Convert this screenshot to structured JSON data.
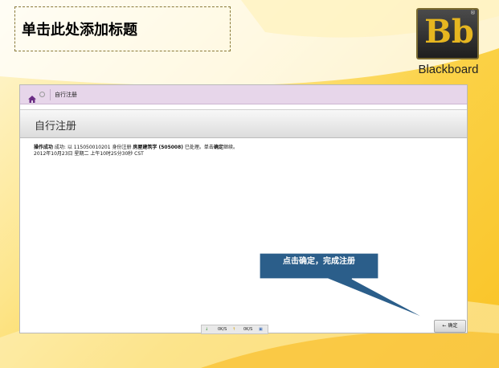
{
  "slide": {
    "title_placeholder": "单击此处添加标题"
  },
  "logo": {
    "mark": "Bb",
    "reg": "®",
    "name": "Blackboard"
  },
  "breadcrumb": {
    "home_icon": "home-icon",
    "current": "自行注册"
  },
  "page": {
    "title": "自行注册",
    "message_bold": "操作成功",
    "message_part1": " 成功: 以 115050010201 身份注册 ",
    "message_course": "房屋建筑学 (505008)",
    "message_part2": " 已处理。单击",
    "message_ok_word": "确定",
    "message_part3": "继续。",
    "timestamp": "2012年10月23日 星期二 上午10时25分30秒 CST",
    "ok_button": "← 确定"
  },
  "statusbar": {
    "down_rate": "0K/S",
    "up_rate": "0K/S"
  },
  "callout": {
    "text": "点击确定，完成注册",
    "fill": "#2b5e8a",
    "border": "#ffffff"
  },
  "colors": {
    "background": "#fcd24a",
    "breadcrumb_bg": "#e7d6ea",
    "logo_gold": "#e6b620"
  }
}
